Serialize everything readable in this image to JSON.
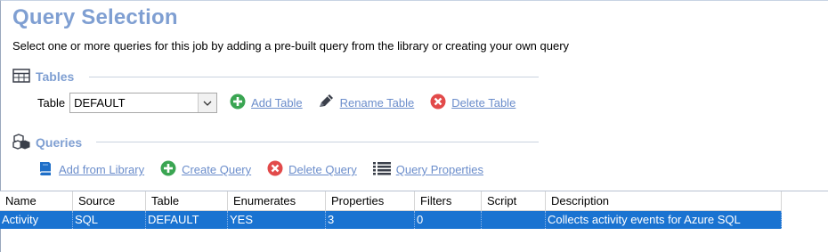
{
  "header": {
    "title": "Query Selection",
    "subtitle": "Select one or more queries for this job by adding a pre-built query from the library or creating your own query"
  },
  "tables_section": {
    "heading": "Tables",
    "icon": "table-grid-icon",
    "table_label": "Table",
    "table_value": "DEFAULT",
    "actions": {
      "add": "Add Table",
      "rename": "Rename Table",
      "delete": "Delete Table"
    }
  },
  "queries_section": {
    "heading": "Queries",
    "icon": "cubes-icon",
    "actions": {
      "add_library": "Add from Library",
      "create": "Create Query",
      "delete": "Delete Query",
      "properties": "Query Properties"
    }
  },
  "grid": {
    "columns": [
      "Name",
      "Source",
      "Table",
      "Enumerates",
      "Properties",
      "Filters",
      "Script",
      "Description"
    ],
    "rows": [
      {
        "cells": [
          "Activity",
          "SQL",
          "DEFAULT",
          "YES",
          "3",
          "0",
          "",
          "Collects activity events for Azure SQL"
        ],
        "selected": true
      }
    ]
  },
  "colors": {
    "title": "#7f9fd2",
    "link": "#6b8dcb",
    "selection": "#1a73d1",
    "add_green": "#3aa552",
    "delete_red": "#e24a4a"
  }
}
